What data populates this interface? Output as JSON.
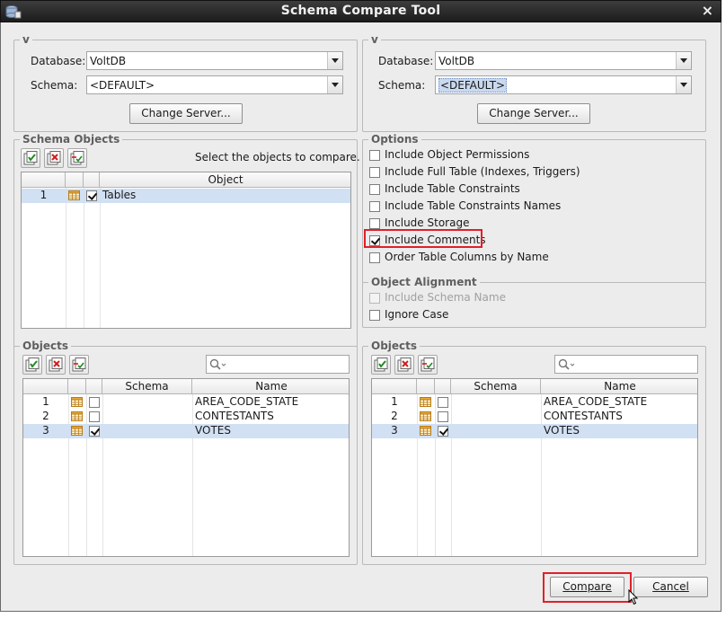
{
  "window": {
    "title": "Schema Compare Tool",
    "close_glyph": "×"
  },
  "source": {
    "legend": "v",
    "database_label": "Database:",
    "database_value": "VoltDB",
    "schema_label": "Schema:",
    "schema_value": "<DEFAULT>",
    "change_server_label": "Change Server..."
  },
  "target": {
    "legend": "v",
    "database_label": "Database:",
    "database_value": "VoltDB",
    "schema_label": "Schema:",
    "schema_value": "<DEFAULT>",
    "change_server_label": "Change Server..."
  },
  "schema_objects": {
    "legend": "Schema Objects",
    "hint": "Select the objects to compare.",
    "column_object": "Object",
    "rows": [
      {
        "num": "1",
        "checked": true,
        "name": "Tables",
        "selected": true
      }
    ]
  },
  "options": {
    "legend": "Options",
    "items": [
      {
        "label": "Include Object Permissions",
        "checked": false
      },
      {
        "label": "Include Full Table (Indexes, Triggers)",
        "checked": false
      },
      {
        "label": "Include Table Constraints",
        "checked": false
      },
      {
        "label": "Include Table Constraints Names",
        "checked": false
      },
      {
        "label": "Include Storage",
        "checked": false
      },
      {
        "label": "Include Comments",
        "checked": true,
        "highlighted": true
      },
      {
        "label": "Order Table Columns by Name",
        "checked": false
      }
    ]
  },
  "object_alignment": {
    "legend": "Object Alignment",
    "items": [
      {
        "label": "Include Schema Name",
        "checked": false,
        "disabled": true
      },
      {
        "label": "Ignore Case",
        "checked": false,
        "disabled": false
      }
    ]
  },
  "objects_left": {
    "legend": "Objects",
    "column_schema": "Schema",
    "column_name": "Name",
    "search_placeholder": "",
    "rows": [
      {
        "num": "1",
        "checked": false,
        "schema": "",
        "name": "AREA_CODE_STATE",
        "selected": false
      },
      {
        "num": "2",
        "checked": false,
        "schema": "",
        "name": "CONTESTANTS",
        "selected": false
      },
      {
        "num": "3",
        "checked": true,
        "schema": "",
        "name": "VOTES",
        "selected": true
      }
    ]
  },
  "objects_right": {
    "legend": "Objects",
    "column_schema": "Schema",
    "column_name": "Name",
    "search_placeholder": "",
    "rows": [
      {
        "num": "1",
        "checked": false,
        "schema": "",
        "name": "AREA_CODE_STATE",
        "selected": false
      },
      {
        "num": "2",
        "checked": false,
        "schema": "",
        "name": "CONTESTANTS",
        "selected": false
      },
      {
        "num": "3",
        "checked": true,
        "schema": "",
        "name": "VOTES",
        "selected": true
      }
    ]
  },
  "footer": {
    "compare_label": "Compare",
    "cancel_label": "Cancel"
  },
  "colors": {
    "highlight_box": "#e0202a",
    "selected_row": "#d1e0f3",
    "titlebar": "#2a2a2a"
  },
  "icons": [
    "app-icon",
    "close-icon",
    "select-all-icon",
    "deselect-all-icon",
    "invert-selection-icon",
    "table-icon",
    "search-icon",
    "dropdown-arrow-icon"
  ]
}
